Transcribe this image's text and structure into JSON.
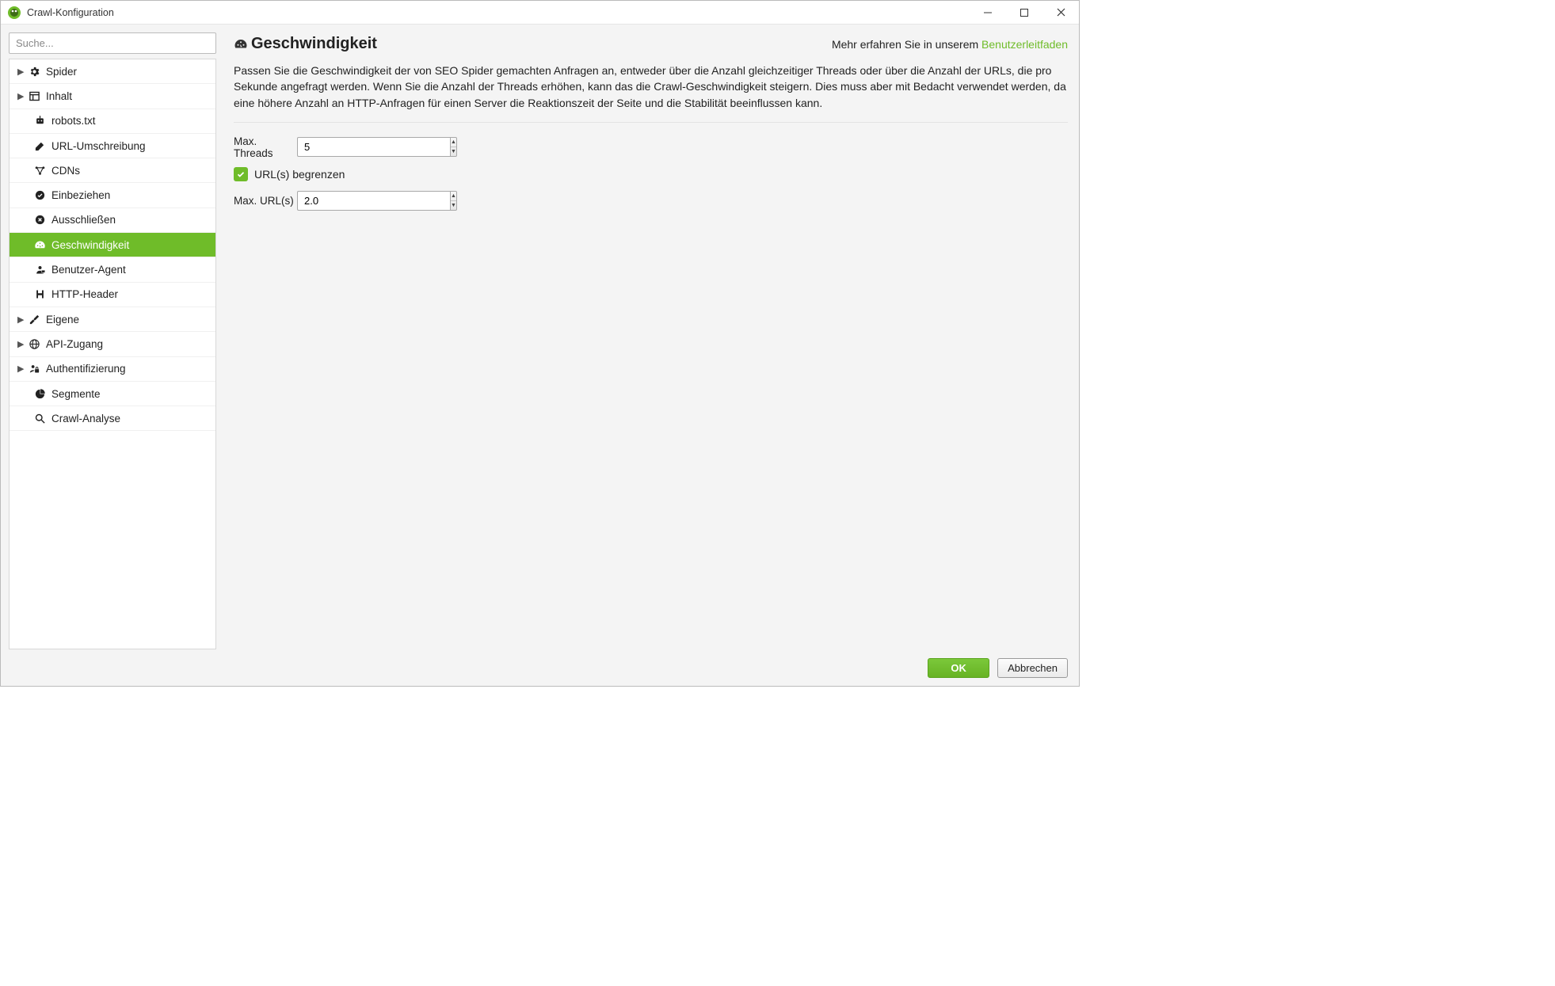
{
  "window": {
    "title": "Crawl-Konfiguration"
  },
  "sidebar": {
    "search_placeholder": "Suche...",
    "items": {
      "spider": "Spider",
      "inhalt": "Inhalt",
      "robots": "robots.txt",
      "urlrewrite": "URL-Umschreibung",
      "cdns": "CDNs",
      "include": "Einbeziehen",
      "exclude": "Ausschließen",
      "speed": "Geschwindigkeit",
      "useragent": "Benutzer-Agent",
      "httpheader": "HTTP-Header",
      "custom": "Eigene",
      "apiaccess": "API-Zugang",
      "auth": "Authentifizierung",
      "segments": "Segmente",
      "crawlanalysis": "Crawl-Analyse"
    }
  },
  "content": {
    "title": "Geschwindigkeit",
    "guide_prefix": "Mehr erfahren Sie in unserem ",
    "guide_link": "Benutzerleitfaden",
    "description": "Passen Sie die Geschwindigkeit der von SEO Spider gemachten Anfragen an, entweder über die Anzahl gleichzeitiger Threads oder über die Anzahl der URLs, die pro Sekunde angefragt werden. Wenn Sie die Anzahl der Threads erhöhen, kann das die Crawl-Geschwindigkeit steigern. Dies muss aber mit Bedacht verwendet werden, da eine höhere Anzahl an HTTP-Anfragen für einen Server die Reaktionszeit der Seite und die Stabilität beeinflussen kann.",
    "max_threads_label": "Max. Threads",
    "max_threads_value": "5",
    "limit_urls_label": "URL(s) begrenzen",
    "limit_urls_checked": true,
    "max_urls_label": "Max. URL(s)",
    "max_urls_value": "2.0"
  },
  "footer": {
    "ok": "OK",
    "cancel": "Abbrechen"
  }
}
